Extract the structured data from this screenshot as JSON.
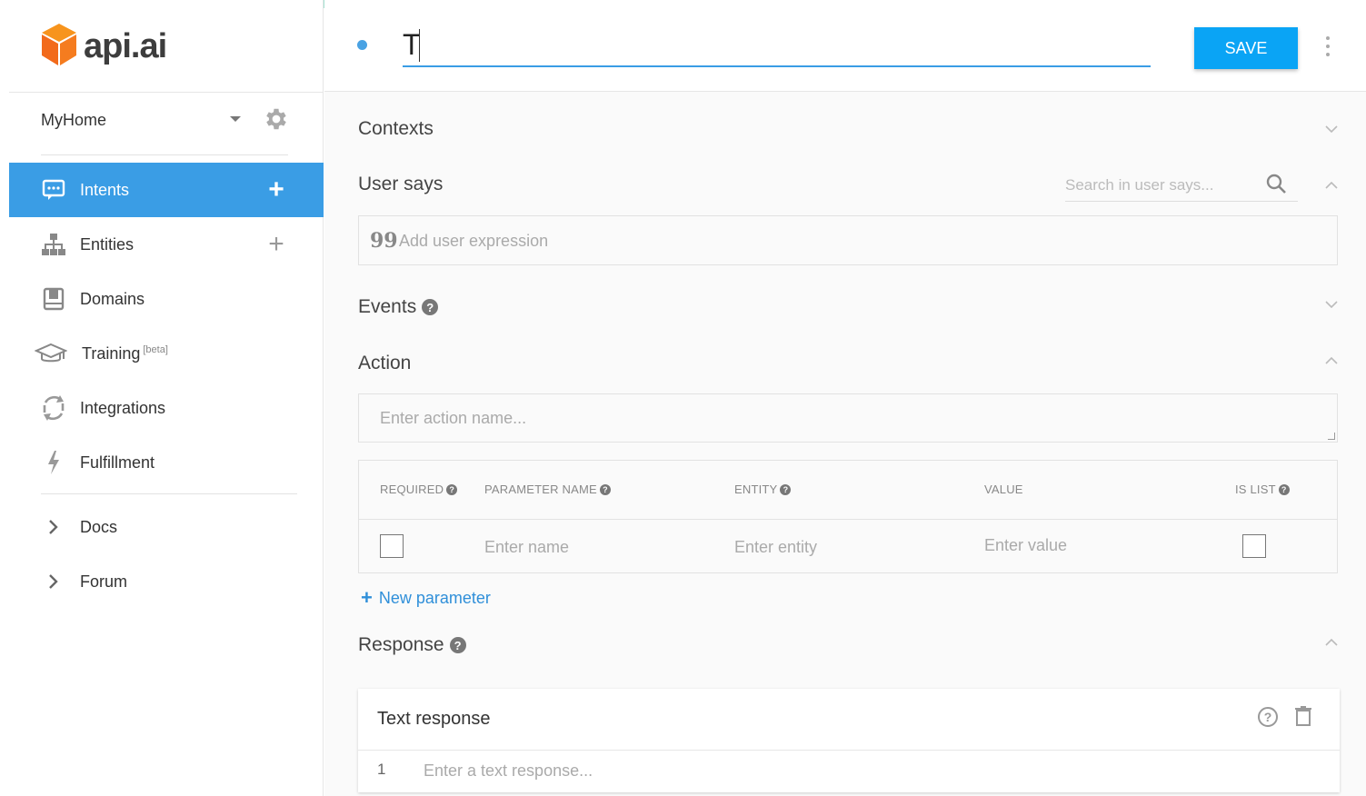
{
  "brand": {
    "name": "api.ai",
    "logo_color": "#f57c1f"
  },
  "agent": {
    "name": "MyHome"
  },
  "sidebar": {
    "items": [
      {
        "label": "Intents",
        "icon": "chat-icon",
        "active": true,
        "has_add": true
      },
      {
        "label": "Entities",
        "icon": "sitemap-icon",
        "active": false,
        "has_add": true
      },
      {
        "label": "Domains",
        "icon": "book-icon",
        "active": false,
        "has_add": false
      },
      {
        "label": "Training",
        "badge": "[beta]",
        "icon": "graduation-cap-icon",
        "active": false,
        "has_add": false
      },
      {
        "label": "Integrations",
        "icon": "sync-icon",
        "active": false,
        "has_add": false
      },
      {
        "label": "Fulfillment",
        "icon": "bolt-icon",
        "active": false,
        "has_add": false
      }
    ],
    "links": [
      {
        "label": "Docs",
        "icon": "chevron-right-icon"
      },
      {
        "label": "Forum",
        "icon": "chevron-right-icon"
      }
    ],
    "add_symbol": "+"
  },
  "header": {
    "intent_name": "T",
    "save_label": "SAVE"
  },
  "sections": {
    "contexts": "Contexts",
    "user_says": "User says",
    "search_placeholder": "Search in user says...",
    "add_expression_placeholder": "Add user expression",
    "quote_glyph": "99",
    "events": "Events",
    "action": "Action",
    "action_placeholder": "Enter action name...",
    "response": "Response"
  },
  "param_table": {
    "headers": {
      "required": "REQUIRED",
      "parameter_name": "PARAMETER NAME",
      "entity": "ENTITY",
      "value": "VALUE",
      "is_list": "IS LIST"
    },
    "row": {
      "name_placeholder": "Enter name",
      "entity_placeholder": "Enter entity",
      "value_placeholder": "Enter value"
    },
    "new_parameter": "New parameter",
    "new_parameter_symbol": "+"
  },
  "response": {
    "card_title": "Text response",
    "row_number": "1",
    "input_placeholder": "Enter a text response..."
  },
  "help_glyph": "?",
  "colors": {
    "accent": "#3a9de5",
    "save_button": "#0aa4f5",
    "link": "#2f8fd9",
    "banner": "#a6e3d3"
  }
}
